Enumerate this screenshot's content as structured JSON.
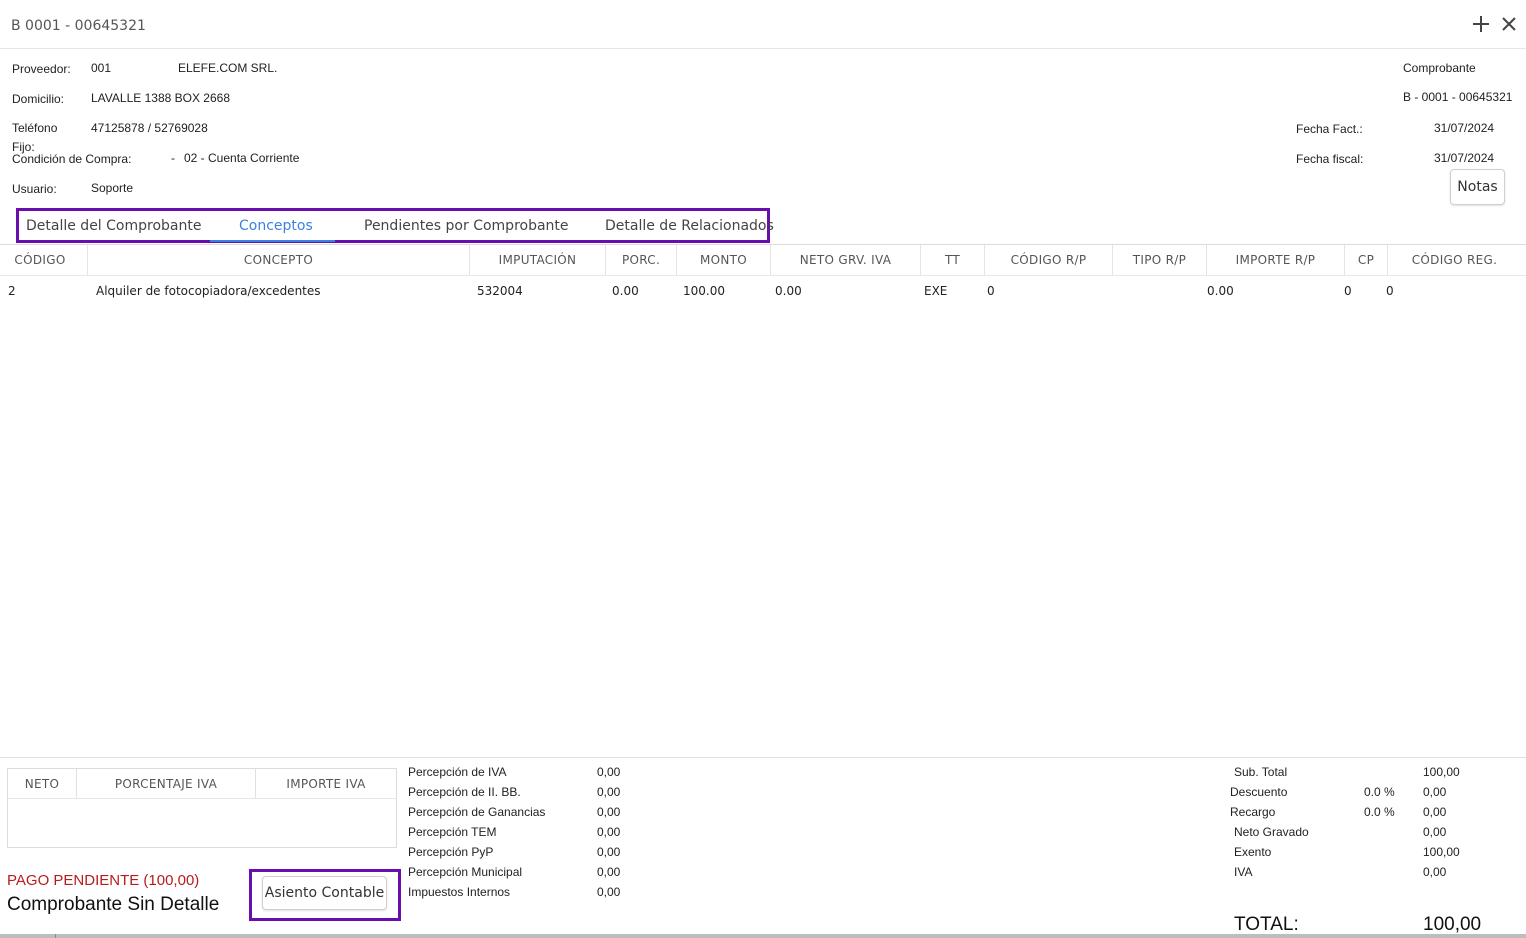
{
  "window": {
    "title": "B 0001 - 00645321"
  },
  "header": {
    "proveedor_label": "Proveedor:",
    "proveedor_code": "001",
    "proveedor_name": "ELEFE.COM SRL.",
    "domicilio_label": "Domicilio:",
    "domicilio_value": "LAVALLE 1388 BOX 2668",
    "telefono_label": "Teléfono",
    "telefono_label2": "Fijo:",
    "telefono_value": "47125878 / 52769028",
    "condicion_label": "Condición de Compra:",
    "condicion_dash": "-",
    "condicion_value": "02 - Cuenta Corriente",
    "usuario_label": "Usuario:",
    "usuario_value": "Soporte",
    "comprobante_label": "Comprobante",
    "comprobante_value": "B - 0001 - 00645321",
    "fecha_fact_label": "Fecha Fact.:",
    "fecha_fact_value": "31/07/2024",
    "fecha_fiscal_label": "Fecha fiscal:",
    "fecha_fiscal_value": "31/07/2024",
    "notas_label": "Notas"
  },
  "tabs": [
    {
      "label": "Detalle del Comprobante"
    },
    {
      "label": "Conceptos"
    },
    {
      "label": "Pendientes por Comprobante"
    },
    {
      "label": "Detalle de Relacionados"
    }
  ],
  "table": {
    "headers": [
      "CÓDIGO",
      "CONCEPTO",
      "IMPUTACIÓN",
      "PORC.",
      "MONTO",
      "NETO GRV. IVA",
      "TT",
      "CÓDIGO R/P",
      "TIPO R/P",
      "IMPORTE R/P",
      "CP",
      "CÓDIGO REG."
    ],
    "rows": [
      [
        "2",
        "Alquiler de fotocopiadora/excedentes",
        "532004",
        "0.00",
        "100.00",
        "0.00",
        "EXE",
        "0",
        "",
        "0.00",
        "0",
        "0"
      ]
    ]
  },
  "iva_table": {
    "headers": [
      "NETO",
      "PORCENTAJE IVA",
      "IMPORTE IVA"
    ]
  },
  "status": {
    "pago": "PAGO PENDIENTE (100,00)",
    "detalle": "Comprobante Sin Detalle",
    "asiento_label": "Asiento Contable"
  },
  "percepciones": [
    {
      "label": "Percepción de IVA",
      "value": "0,00"
    },
    {
      "label": "Percepción de II. BB.",
      "value": "0,00"
    },
    {
      "label": "Percepción de Ganancias",
      "value": "0,00"
    },
    {
      "label": "Percepción TEM",
      "value": "0,00"
    },
    {
      "label": "Percepción PyP",
      "value": "0,00"
    },
    {
      "label": "Percepción Municipal",
      "value": "0,00"
    },
    {
      "label": "Impuestos Internos",
      "value": "0,00"
    }
  ],
  "totales": {
    "subtotal_label": "Sub. Total",
    "subtotal_value": "100,00",
    "descuento_label": "Descuento",
    "descuento_pct": "0.0 %",
    "descuento_value": "0,00",
    "recargo_label": "Recargo",
    "recargo_pct": "0.0 %",
    "recargo_value": "0,00",
    "neto_label": "Neto Gravado",
    "neto_value": "0,00",
    "exento_label": "Exento",
    "exento_value": "100,00",
    "iva_label": "IVA",
    "iva_value": "0,00",
    "total_label": "TOTAL:",
    "total_value": "100,00"
  },
  "colors": {
    "accent": "#3b82e0",
    "highlight_box": "#6a0dad",
    "pending": "#b71c1c"
  }
}
